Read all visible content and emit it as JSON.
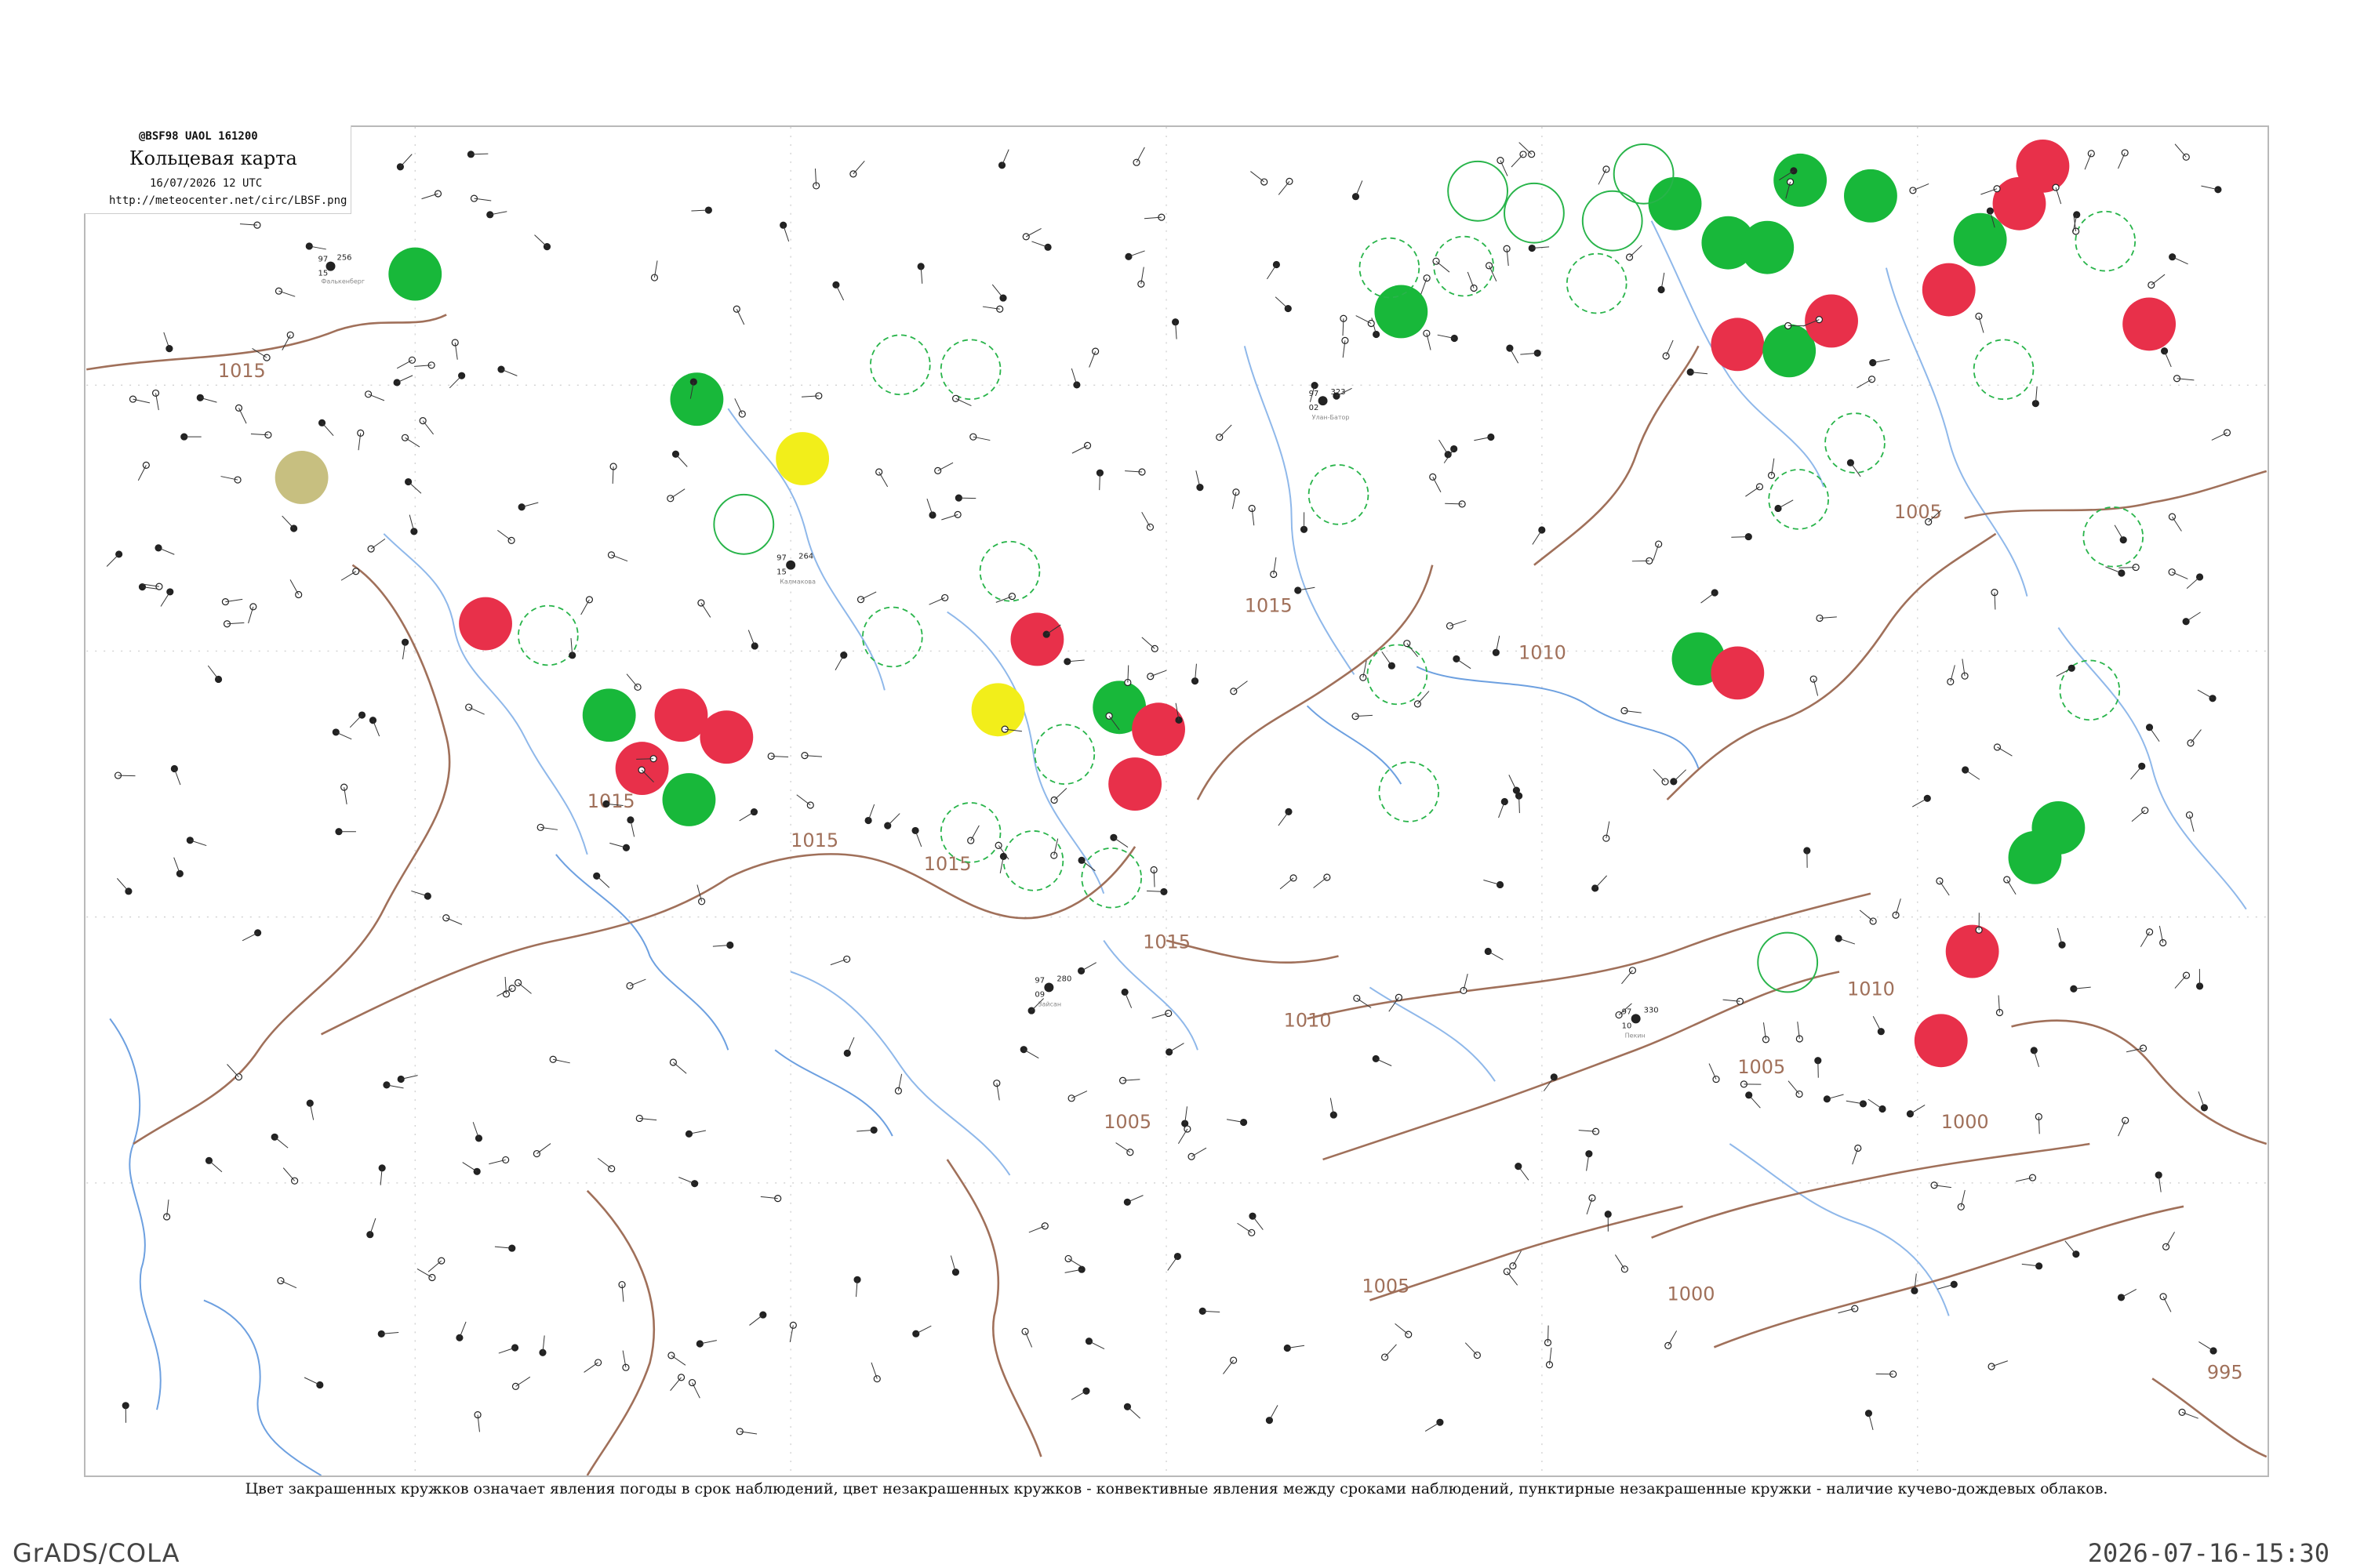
{
  "header": {
    "code": "@BSF98  UAOL  161200",
    "title": "Кольцевая карта",
    "date_time": "16/07/2026 12 UTC",
    "url": "http://meteocenter.net/circ/LBSF.png"
  },
  "caption": "Цвет закрашенных кружков означает явления погоды в срок наблюдений, цвет незакрашенных кружков - конвективные явления между сроками наблюдений, пунктирные незакрашенные кружки - наличие кучево-дождевых облаков.",
  "footer": {
    "left": "GrADS/COLA",
    "right": "2026-07-16-15:30"
  },
  "colors": {
    "thunderstorm": "#e8304a",
    "shower": "#18b83a",
    "hazy": "#f2ee1a",
    "dust": "#c7bf80",
    "isobar": "#a0705a",
    "river": "#8fb8ea"
  },
  "isobar_labels": [
    "1015",
    "1015",
    "1015",
    "1015",
    "1015",
    "1015",
    "1010",
    "1010",
    "1005",
    "1005",
    "1010",
    "1000",
    "1005",
    "1000",
    "1005",
    "995"
  ],
  "stations": [
    {
      "name": "Фалькенберг",
      "pressure": "256",
      "temp": "97",
      "dew": "15",
      "wx": "green-fill"
    },
    {
      "name": "Улан-Батор",
      "pressure": "323",
      "temp": "97",
      "dew": "02",
      "wx": "green-fill"
    },
    {
      "name": "Зайсан",
      "pressure": "280",
      "temp": "97",
      "dew": "09",
      "wx": "red-fill"
    },
    {
      "name": "Калмакова",
      "pressure": "264",
      "temp": "97",
      "dew": "15",
      "wx": "yellow-fill"
    },
    {
      "name": "Пекин",
      "pressure": "330",
      "temp": "97",
      "dew": "10",
      "wx": "none"
    }
  ]
}
